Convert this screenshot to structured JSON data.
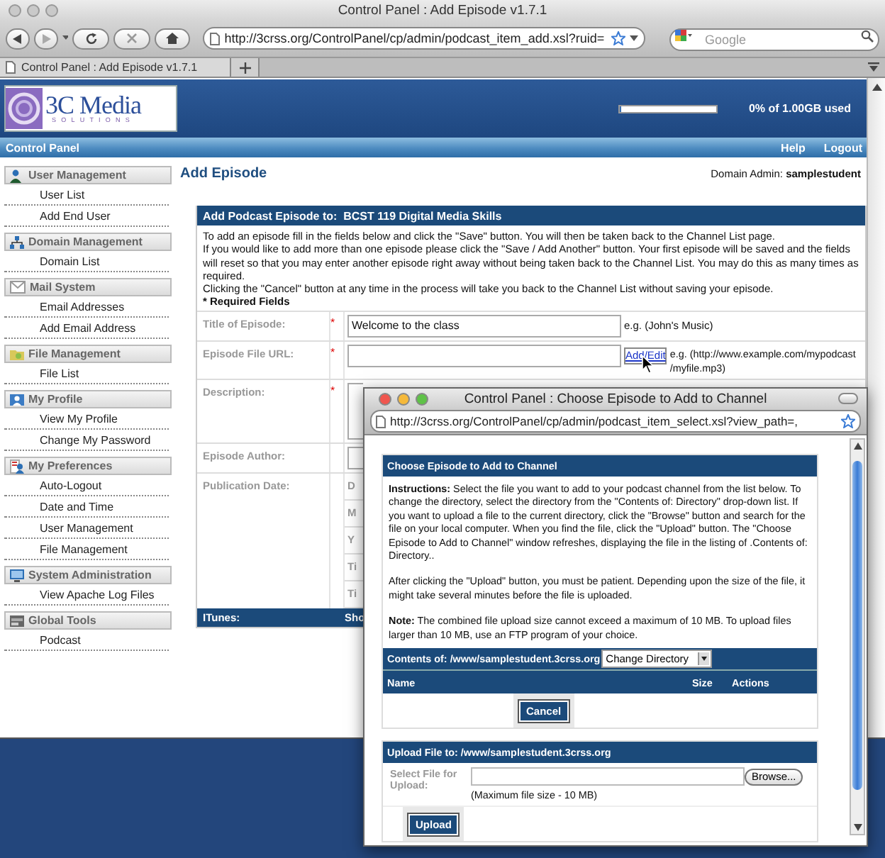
{
  "browser": {
    "title": "Control Panel : Add Episode v1.7.1",
    "url": "http://3crss.org/ControlPanel/cp/admin/podcast_item_add.xsl?ruid=",
    "search_placeholder": "Google",
    "tab": "Control Panel : Add Episode v1.7.1"
  },
  "header": {
    "logo_name": "3C Media",
    "logo_tagline": "SOLUTIONS",
    "storage_meter": {
      "level": 0.02
    },
    "storage_label": "0% of 1.00GB used"
  },
  "navbar": {
    "title": "Control Panel",
    "links": [
      "Help",
      "Logout"
    ]
  },
  "sidebar": {
    "sections": [
      {
        "title": "User Management",
        "kind": "users",
        "items": [
          "User List",
          "Add End User"
        ]
      },
      {
        "title": "Domain Management",
        "kind": "network",
        "items": [
          "Domain List"
        ]
      },
      {
        "title": "Mail System",
        "kind": "mail",
        "items": [
          "Email Addresses",
          "Add Email Address"
        ]
      },
      {
        "title": "File Management",
        "kind": "files",
        "items": [
          "File List"
        ]
      },
      {
        "title": "My Profile",
        "kind": "profile",
        "items": [
          "View My Profile",
          "Change My Password"
        ]
      },
      {
        "title": "My Preferences",
        "kind": "preferences",
        "items": [
          "Auto-Logout",
          "Date and Time",
          "User Management",
          "File Management"
        ]
      },
      {
        "title": "System Administration",
        "kind": "admin",
        "items": [
          "View Apache Log Files"
        ]
      },
      {
        "title": "Global Tools",
        "kind": "tools",
        "items": [
          "Podcast"
        ]
      }
    ]
  },
  "page": {
    "title": "Add Episode",
    "admin": "Domain Admin: **samplestudent**"
  },
  "form": {
    "heading": "Add Podcast Episode to:  BCST 119 Digital Media Skills",
    "instructions": [
      "To add an episode fill in the fields below and click the \"Save\" button. You will then be taken back to the Channel List page.",
      "If you would like to add more than one episode please click the \"Save / Add Another\" button. Your first episode will be saved and the fields will reset so that you may enter another episode right away without being taken back to the Channel List. You may do this as many times as required.",
      "Clicking the \"Cancel\" button at any time in the process will take you back to the Channel List without saving your episode."
    ],
    "required_note": "* Required Fields",
    "required_mark": "*",
    "fields": [
      {
        "kind": "text",
        "label": "Title of Episode:",
        "required": true,
        "value": "Welcome to the class",
        "example": "e.g. (John's Music)"
      },
      {
        "kind": "url",
        "label": "Episode File URL:",
        "required": true,
        "link": "Add/Edit",
        "example": "e.g. (http://www.example.com/mypodcast /myfile.mp3)"
      },
      {
        "kind": "textarea",
        "label": "Description:",
        "required": true
      },
      {
        "kind": "text",
        "label": "Episode Author:",
        "required": false
      },
      {
        "kind": "date",
        "label": "Publication Date:",
        "required": false,
        "parts": [
          "D",
          "M",
          "Y",
          "Ti",
          "Ti"
        ]
      }
    ],
    "section": {
      "heading": "ITunes:",
      "column_2": "Sho"
    }
  },
  "popup": {
    "title": "Control Panel : Choose Episode to Add to Channel",
    "url": "http://3crss.org/ControlPanel/cp/admin/podcast_item_select.xsl?view_path=,",
    "heading": "Choose Episode to Add to Channel",
    "paragraphs": [
      "**Instructions:** Select the file you want to add to your podcast channel from the list below. To change the directory, select the directory from the \"Contents of: Directory\" drop-down list. If you want to upload a file to the current directory, click the \"Browse\" button and search for the file on your local computer. When you find the file, click the \"Upload\" button. The \"Choose Episode to Add to Channel\" window refreshes, displaying the file in the listing of .Contents of: Directory..",
      "After clicking the \"Upload\" button, you must be patient. Depending upon the size of the file, it might take several minutes before the file is uploaded.",
      "**Note:** The combined file upload size cannot exceed a maximum of 10 MB. To upload files larger than 10 MB, use an FTP program of your choice."
    ],
    "contents_label": "Contents of: /www/samplestudent.3crss.org",
    "directory_select": "Change Directory",
    "columns": [
      "Name",
      "Size",
      "Actions"
    ],
    "cancel": "Cancel",
    "upload_heading": "Upload File to: /www/samplestudent.3crss.org",
    "file_label": "Select File for Upload:",
    "browse": "Browse...",
    "file_hint": "(Maximum file size - 10 MB)",
    "upload": "Upload"
  }
}
